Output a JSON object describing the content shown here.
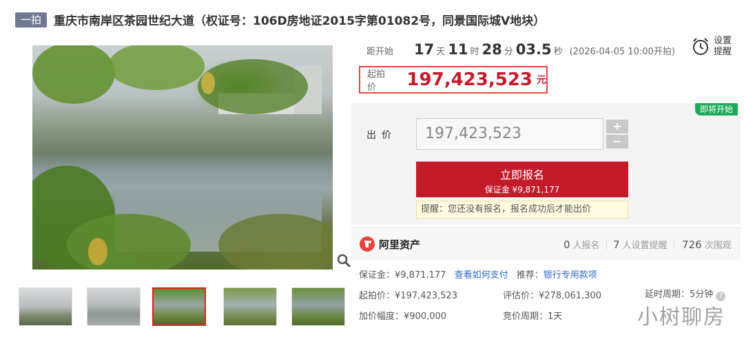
{
  "header": {
    "badge": "一拍",
    "title": "重庆市南岸区茶园世纪大道（权证号：106D房地证2015字第01082号，同景国际城V地块）"
  },
  "countdown": {
    "label": "距开始",
    "days": "17",
    "days_unit": "天",
    "hours": "11",
    "hours_unit": "时",
    "minutes": "28",
    "minutes_unit": "分",
    "seconds": "03.5",
    "seconds_unit": "秒",
    "start_note": "(2026-04-05 10:00开拍)"
  },
  "reminder": {
    "icon": "alarm-clock-icon",
    "line1": "设置",
    "line2": "提醒"
  },
  "start_price": {
    "label": "起拍价",
    "value": "197,423,523",
    "unit": "元"
  },
  "bid_panel": {
    "status_tag": "即将开始",
    "bid_label": "出价",
    "bid_value": "197,423,523",
    "plus": "+",
    "minus": "−",
    "signup_label": "立即报名",
    "deposit_line": "保证金 ¥9,871,177",
    "notice": "提醒：您还没有报名，报名成功后才能出价"
  },
  "stats": {
    "brand": "阿里资产",
    "signups_count": "0",
    "signups_label": "人报名",
    "reminders_count": "7",
    "reminders_label": "人设置提醒",
    "views_count": "726",
    "views_label": "次围观"
  },
  "details": {
    "deposit": "保证金：¥9,871,177",
    "how_to_pay": "查看如何支付",
    "recommend_label": "推荐：",
    "recommend_link": "银行专用款项",
    "start_price": "起拍价：¥197,423,523",
    "appraisal": "评估价：¥278,061,300",
    "delay": "延时周期：5分钟",
    "increment": "加价幅度：¥900,000",
    "bid_period": "竞价周期：1天"
  },
  "watermark": "小树聊房",
  "colors": {
    "accent_red": "#c31b2a",
    "price_border": "#e8433c",
    "green_tag": "#1fa95c",
    "link_blue": "#2a6ac8"
  }
}
